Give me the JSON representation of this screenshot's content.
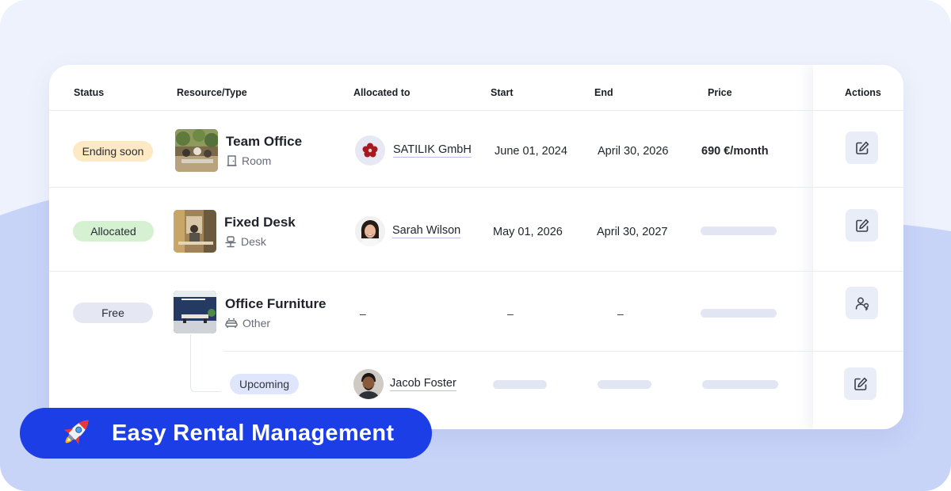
{
  "table": {
    "headers": {
      "status": "Status",
      "resource": "Resource/Type",
      "allocated": "Allocated to",
      "start": "Start",
      "end": "End",
      "price": "Price",
      "actions": "Actions"
    },
    "rows": [
      {
        "status": "Ending soon",
        "name": "Team Office",
        "type": "Room",
        "allocated_to": "SATILIK GmbH",
        "start": "June 01, 2024",
        "end": "April 30, 2026",
        "price": "690 €/month",
        "action_icon": "edit-icon"
      },
      {
        "status": "Allocated",
        "name": "Fixed Desk",
        "type": "Desk",
        "allocated_to": "Sarah Wilson",
        "start": "May 01, 2026",
        "end": "April 30, 2027",
        "action_icon": "edit-icon"
      },
      {
        "status": "Free",
        "name": "Office Furniture",
        "type": "Other",
        "allocated_to": "–",
        "start": "–",
        "end": "–",
        "action_icon": "assign-user-icon"
      }
    ],
    "subrow": {
      "status": "Upcoming",
      "allocated_to": "Jacob Foster",
      "action_icon": "edit-icon"
    }
  },
  "banner": {
    "icon": "rocket-icon",
    "text": "Easy Rental Management"
  },
  "colors": {
    "banner": "#1c3ee6",
    "ending_soon": "#fde9c4",
    "allocated": "#d6f1d2",
    "free": "#e5e8f3",
    "upcoming": "#dfe5fb",
    "background": "#eef2fc",
    "background_wave": "#c8d3f8"
  }
}
